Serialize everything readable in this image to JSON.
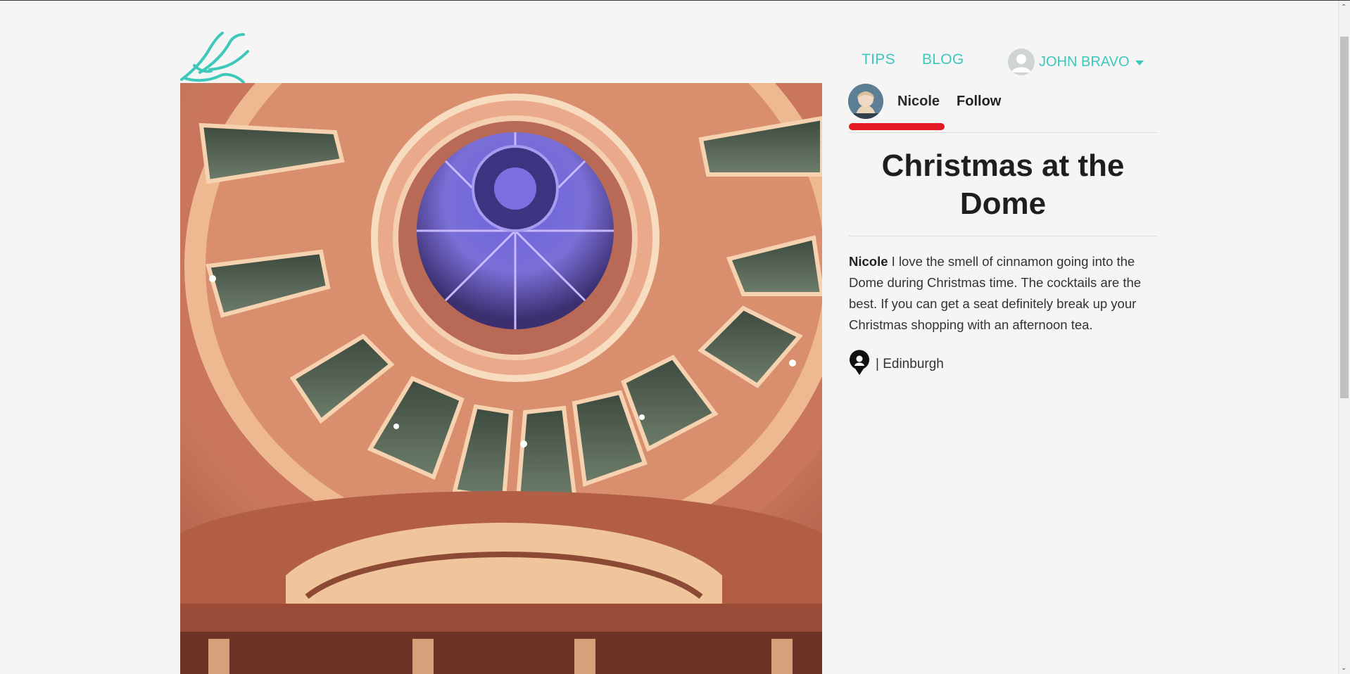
{
  "header": {
    "logo": "swallow-logo",
    "nav": {
      "tips_label": "TIPS",
      "blog_label": "BLOG"
    },
    "user": {
      "name": "JOHN BRAVO"
    }
  },
  "post": {
    "image": "dome-ceiling-photo",
    "author": {
      "name": "Nicole",
      "follow_label": "Follow"
    },
    "title": "Christmas at the Dome",
    "body": {
      "author": "Nicole",
      "text": " I love the smell of cinnamon going into the Dome during Christmas time. The cocktails are the best. If you can get a seat definitely break up your Christmas shopping with an afternoon tea."
    },
    "location": {
      "icon": "map-pin-icon",
      "separator": "| ",
      "name": "Edinburgh"
    }
  },
  "colors": {
    "accent": "#3cc8bb",
    "underline": "#e51b24",
    "background": "#f5f5f5"
  }
}
